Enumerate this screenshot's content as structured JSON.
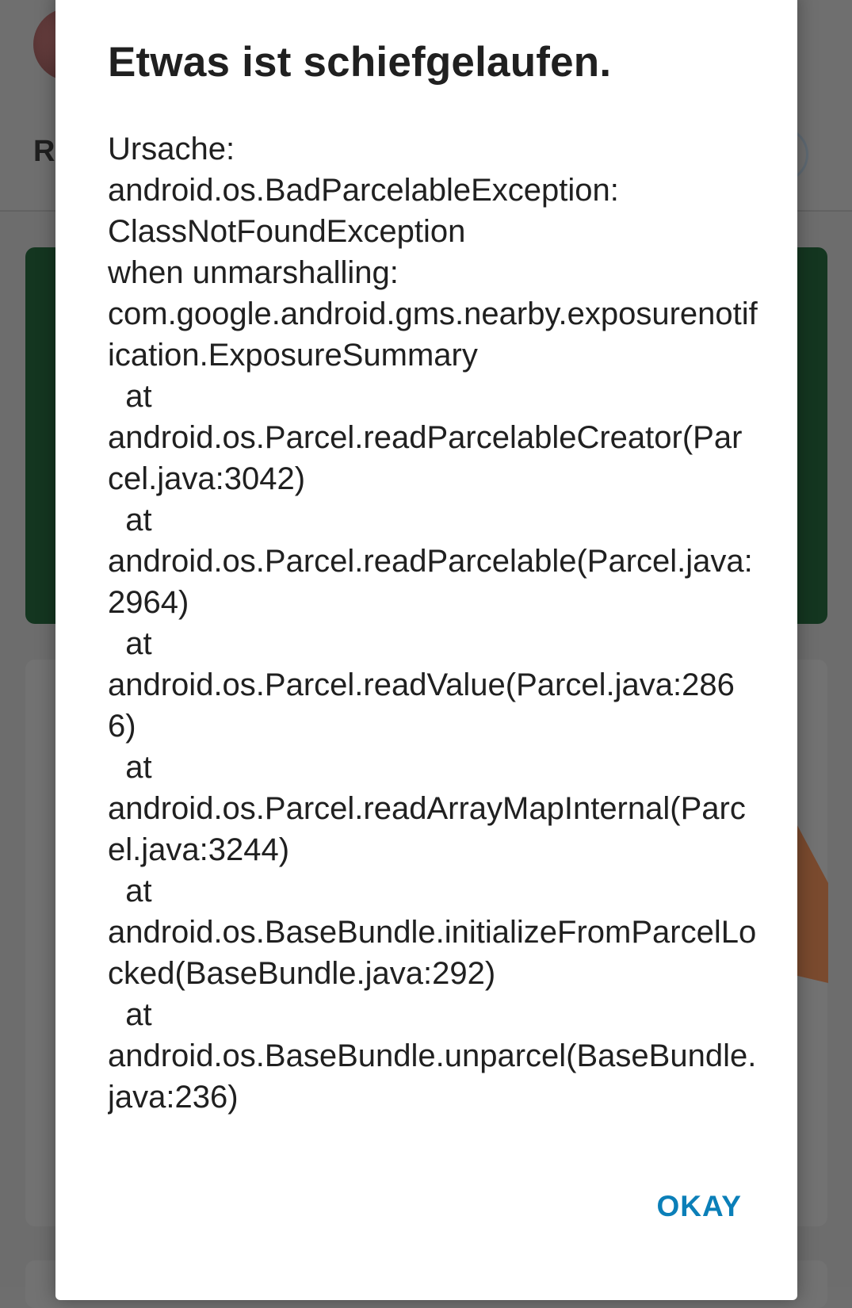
{
  "background_app": {
    "title_fragment": "R"
  },
  "dialog": {
    "title": "Etwas ist schiefgelaufen.",
    "message": "Ursache:\nandroid.os.BadParcelableException:\nClassNotFoundException\nwhen unmarshalling:\ncom.google.android.gms.nearby.exposurenotification.ExposureSummary\n  at\nandroid.os.Parcel.readParcelableCreator(Parcel.java:3042)\n  at\nandroid.os.Parcel.readParcelable(Parcel.java:2964)\n  at\nandroid.os.Parcel.readValue(Parcel.java:2866)\n  at\nandroid.os.Parcel.readArrayMapInternal(Parcel.java:3244)\n  at\nandroid.os.BaseBundle.initializeFromParcelLocked(BaseBundle.java:292)\n  at\nandroid.os.BaseBundle.unparcel(BaseBundle.java:236)",
    "okay_label": "OKAY"
  },
  "colors": {
    "accent": "#0b7fb8",
    "green_card": "#143620",
    "scrim": "#6e6e6e"
  }
}
